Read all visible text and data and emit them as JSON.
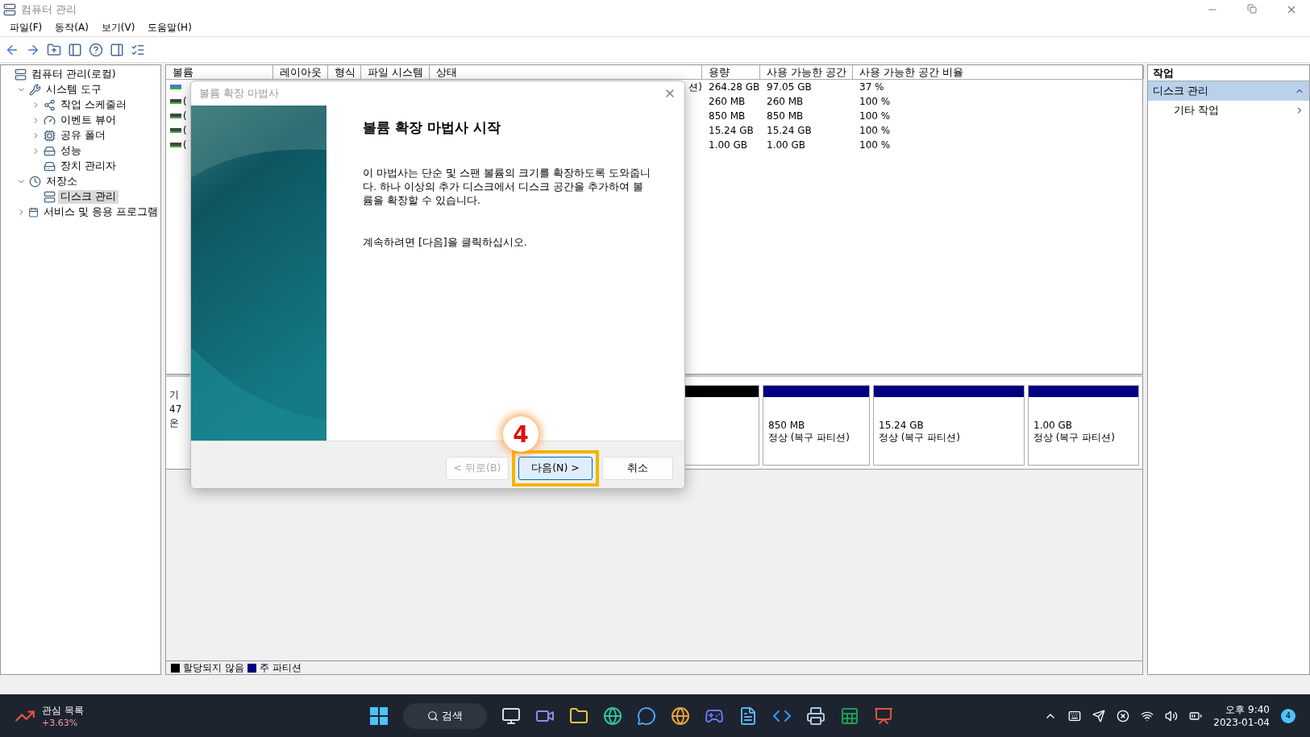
{
  "window": {
    "title": "컴퓨터 관리"
  },
  "menu": [
    {
      "label": "파일(F)"
    },
    {
      "label": "동작(A)"
    },
    {
      "label": "보기(V)"
    },
    {
      "label": "도움말(H)"
    }
  ],
  "tree": [
    {
      "label": "컴퓨터 관리(로컬)",
      "selected": false,
      "children": [
        {
          "label": "시스템 도구",
          "selected": false,
          "expanded": true,
          "children": [
            {
              "label": "작업 스케줄러",
              "selected": false,
              "expanded": false
            },
            {
              "label": "이벤트 뷰어",
              "selected": false,
              "expanded": false
            },
            {
              "label": "공유 폴더",
              "selected": false,
              "expanded": false
            },
            {
              "label": "성능",
              "selected": false,
              "expanded": false
            },
            {
              "label": "장치 관리자",
              "selected": false
            }
          ]
        },
        {
          "label": "저장소",
          "selected": false,
          "expanded": true,
          "children": [
            {
              "label": "디스크 관리",
              "selected": true
            }
          ]
        },
        {
          "label": "서비스 및 응용 프로그램",
          "selected": false,
          "expanded": false
        }
      ]
    }
  ],
  "table": {
    "columns": [
      "볼륨",
      "레이아웃",
      "형식",
      "파일 시스템",
      "상태",
      "용량",
      "사용 가능한 공간",
      "사용 가능한 공간 비율"
    ],
    "rows": [
      {
        "volume": "",
        "status": "션)",
        "capacity": "264.28 GB",
        "free": "97.05 GB",
        "percent": "37 %",
        "kind": "system"
      },
      {
        "volume": "(",
        "status": "",
        "capacity": "260 MB",
        "free": "260 MB",
        "percent": "100 %",
        "kind": "plain"
      },
      {
        "volume": "(",
        "status": "",
        "capacity": "850 MB",
        "free": "850 MB",
        "percent": "100 %",
        "kind": "plain"
      },
      {
        "volume": "(",
        "status": "",
        "capacity": "15.24 GB",
        "free": "15.24 GB",
        "percent": "100 %",
        "kind": "plain"
      },
      {
        "volume": "(",
        "status": "",
        "capacity": "1.00 GB",
        "free": "1.00 GB",
        "percent": "100 %",
        "kind": "plain"
      }
    ]
  },
  "disk": {
    "info": [
      "기",
      "47",
      "온"
    ],
    "partitions": [
      {
        "color": "#000000"
      },
      {
        "color": "#000080",
        "size": "850 MB",
        "status": "정상 (복구 파티션)"
      },
      {
        "color": "#000080",
        "size": "15.24 GB",
        "status": "정상 (복구 파티션)"
      },
      {
        "color": "#000080",
        "size": "1.00 GB",
        "status": "정상 (복구 파티션)"
      }
    ]
  },
  "legend": [
    {
      "label": "할당되지 않음",
      "color": "#000000"
    },
    {
      "label": "주 파티션",
      "color": "#000080"
    }
  ],
  "actions": {
    "title": "작업",
    "section": {
      "label": "디스크 관리",
      "expanded": true
    },
    "items": [
      "기타 작업"
    ]
  },
  "dialog": {
    "title": "볼륨 확장 마법사",
    "heading": "볼륨 확장 마법사 시작",
    "body": "이 마법사는 단순 및 스팬 볼륨의 크기를 확장하도록 도와줍니다. 하나 이상의 추가 디스크에서 디스크 공간을 추가하여 볼륨을 확장할 수 있습니다.",
    "hint": "계속하려면 [다음]을 클릭하십시오.",
    "buttons": [
      {
        "label": "< 뒤로(B)",
        "disabled": true,
        "highlighted": false
      },
      {
        "label": "다음(N) >",
        "disabled": false,
        "highlighted": true
      },
      {
        "label": "취소",
        "disabled": false,
        "highlighted": false
      }
    ],
    "step_badge": "4"
  },
  "taskbar": {
    "widget": {
      "title": "관심 목록",
      "change": "+3.63%"
    },
    "search": "검색",
    "time": "오후 9:40",
    "date": "2023-01-04",
    "notifications": "4"
  }
}
